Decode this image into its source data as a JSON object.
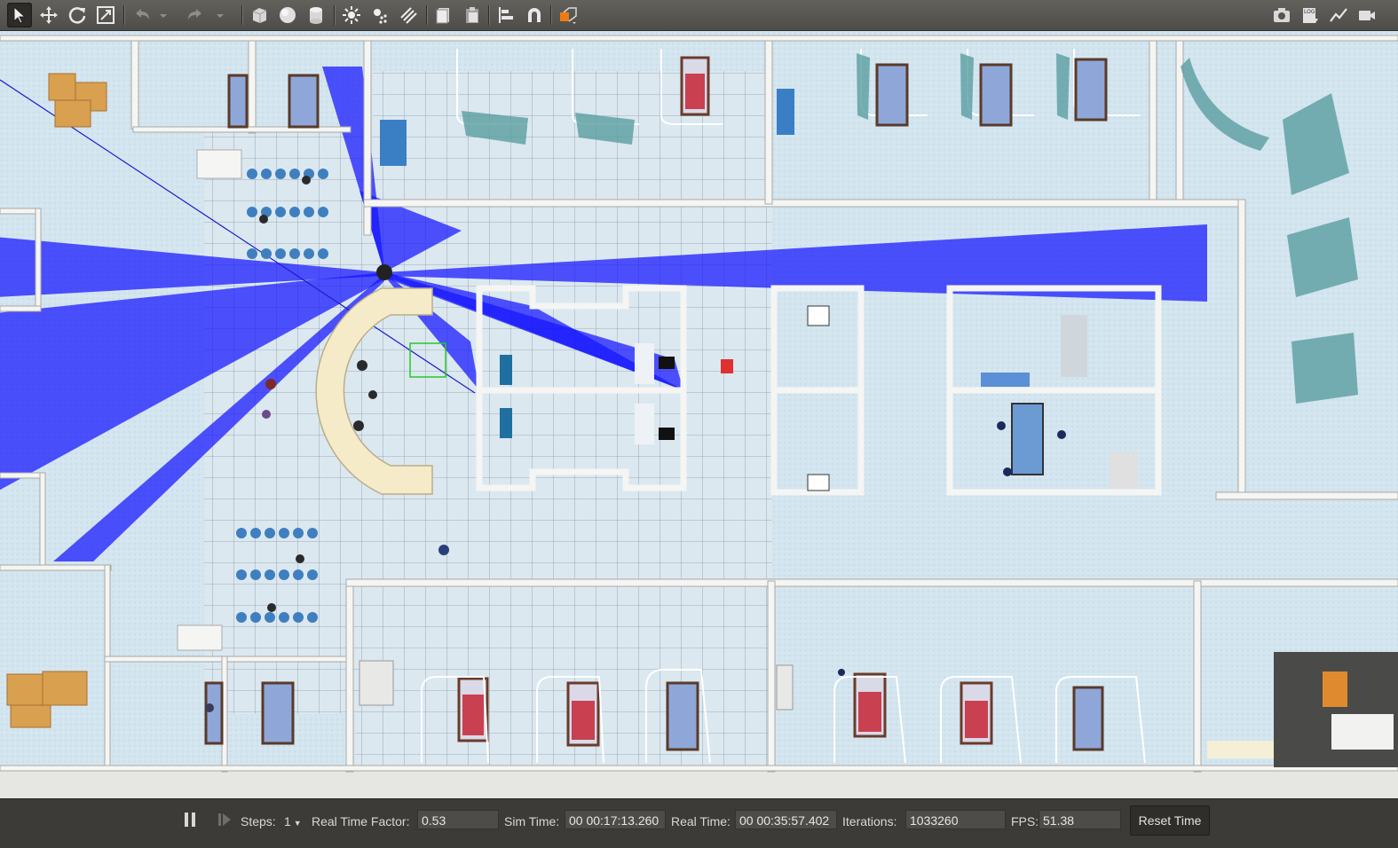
{
  "toolbar": {
    "left_tools": [
      "select-arrow-icon",
      "translate-icon",
      "rotate-icon",
      "scale-icon",
      "undo-icon",
      "redo-icon",
      "box-shape-icon",
      "sphere-shape-icon",
      "cylinder-shape-icon",
      "point-light-icon",
      "spot-light-icon",
      "directional-light-icon",
      "copy-icon",
      "paste-icon",
      "align-icon",
      "snap-magnet-icon",
      "view-angle-icon"
    ],
    "right_tools": [
      "screenshot-camera-icon",
      "log-icon",
      "plot-icon",
      "record-video-icon"
    ],
    "log_label": "LOG",
    "accent": "#f07a12"
  },
  "viewport": {
    "floor_color": "#d6e6f0",
    "wall_color": "#ffffff",
    "laser_color": "#1a1aff"
  },
  "statusbar": {
    "steps_label": "Steps:",
    "steps_value": "1",
    "real_time_factor_label": "Real Time Factor:",
    "real_time_factor_value": "0.53",
    "sim_time_label": "Sim Time:",
    "sim_time_value": "00 00:17:13.260",
    "real_time_label": "Real Time:",
    "real_time_value": "00 00:35:57.402",
    "iterations_label": "Iterations:",
    "iterations_value": "1033260",
    "fps_label": "FPS:",
    "fps_value": "51.38",
    "reset_label": "Reset Time"
  }
}
